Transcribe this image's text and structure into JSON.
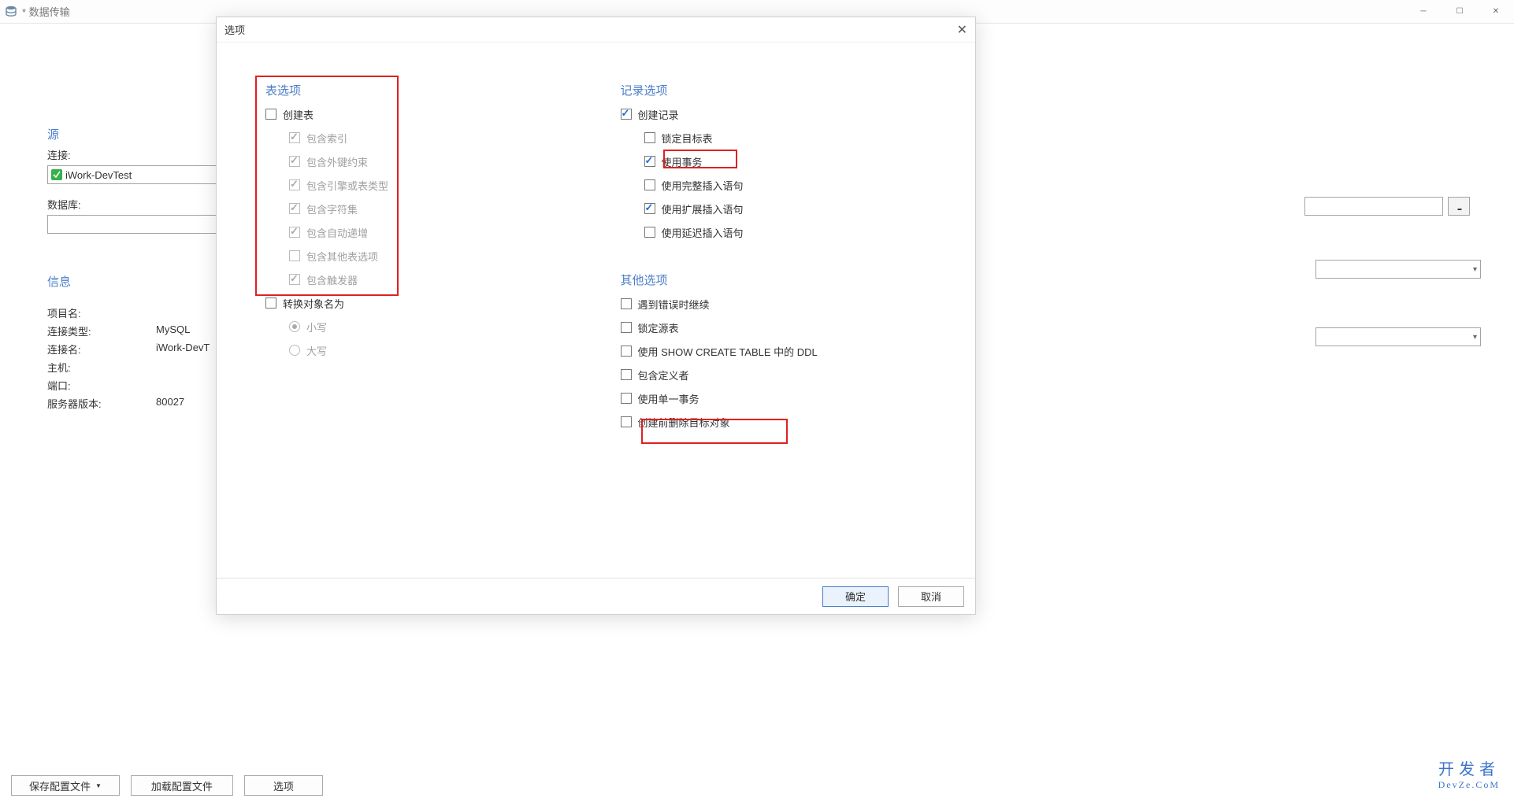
{
  "titlebar": {
    "title": "* 数据传输"
  },
  "bg": {
    "source_heading": "源",
    "connection_label": "连接:",
    "connection_value": "iWork-DevTest",
    "database_label": "数据库:",
    "info_heading": "信息",
    "info": {
      "project_name_label": "项目名:",
      "project_name_value": "",
      "conn_type_label": "连接类型:",
      "conn_type_value": "MySQL",
      "conn_name_label": "连接名:",
      "conn_name_value": "iWork-DevT",
      "host_label": "主机:",
      "host_value": "",
      "port_label": "端口:",
      "port_value": "",
      "server_ver_label": "服务器版本:",
      "server_ver_value": "80027"
    }
  },
  "bottombar": {
    "save_profile": "保存配置文件",
    "load_profile": "加载配置文件",
    "options": "选项"
  },
  "watermark": {
    "line1": "开发者",
    "line2": "DevZe.CoM"
  },
  "dialog": {
    "title": "选项",
    "table_options": {
      "heading": "表选项",
      "create_table": "创建表",
      "include_index": "包含索引",
      "include_fk": "包含外键约束",
      "include_engine": "包含引擎或表类型",
      "include_charset": "包含字符集",
      "include_autoinc": "包含自动递增",
      "include_other": "包含其他表选项",
      "include_trigger": "包含触发器",
      "convert_names": "转换对象名为",
      "lowercase": "小写",
      "uppercase": "大写"
    },
    "record_options": {
      "heading": "记录选项",
      "create_record": "创建记录",
      "lock_target": "锁定目标表",
      "use_tx": "使用事务",
      "use_full_insert": "使用完整插入语句",
      "use_ext_insert": "使用扩展插入语句",
      "use_delayed_insert": "使用延迟插入语句"
    },
    "other_options": {
      "heading": "其他选项",
      "continue_on_error": "遇到错误时继续",
      "lock_source": "锁定源表",
      "use_show_create": "使用 SHOW CREATE TABLE 中的 DDL",
      "include_definer": "包含定义者",
      "use_single_tx": "使用单一事务",
      "delete_before_create": "创建前删除目标对象"
    },
    "footer": {
      "ok": "确定",
      "cancel": "取消"
    }
  }
}
